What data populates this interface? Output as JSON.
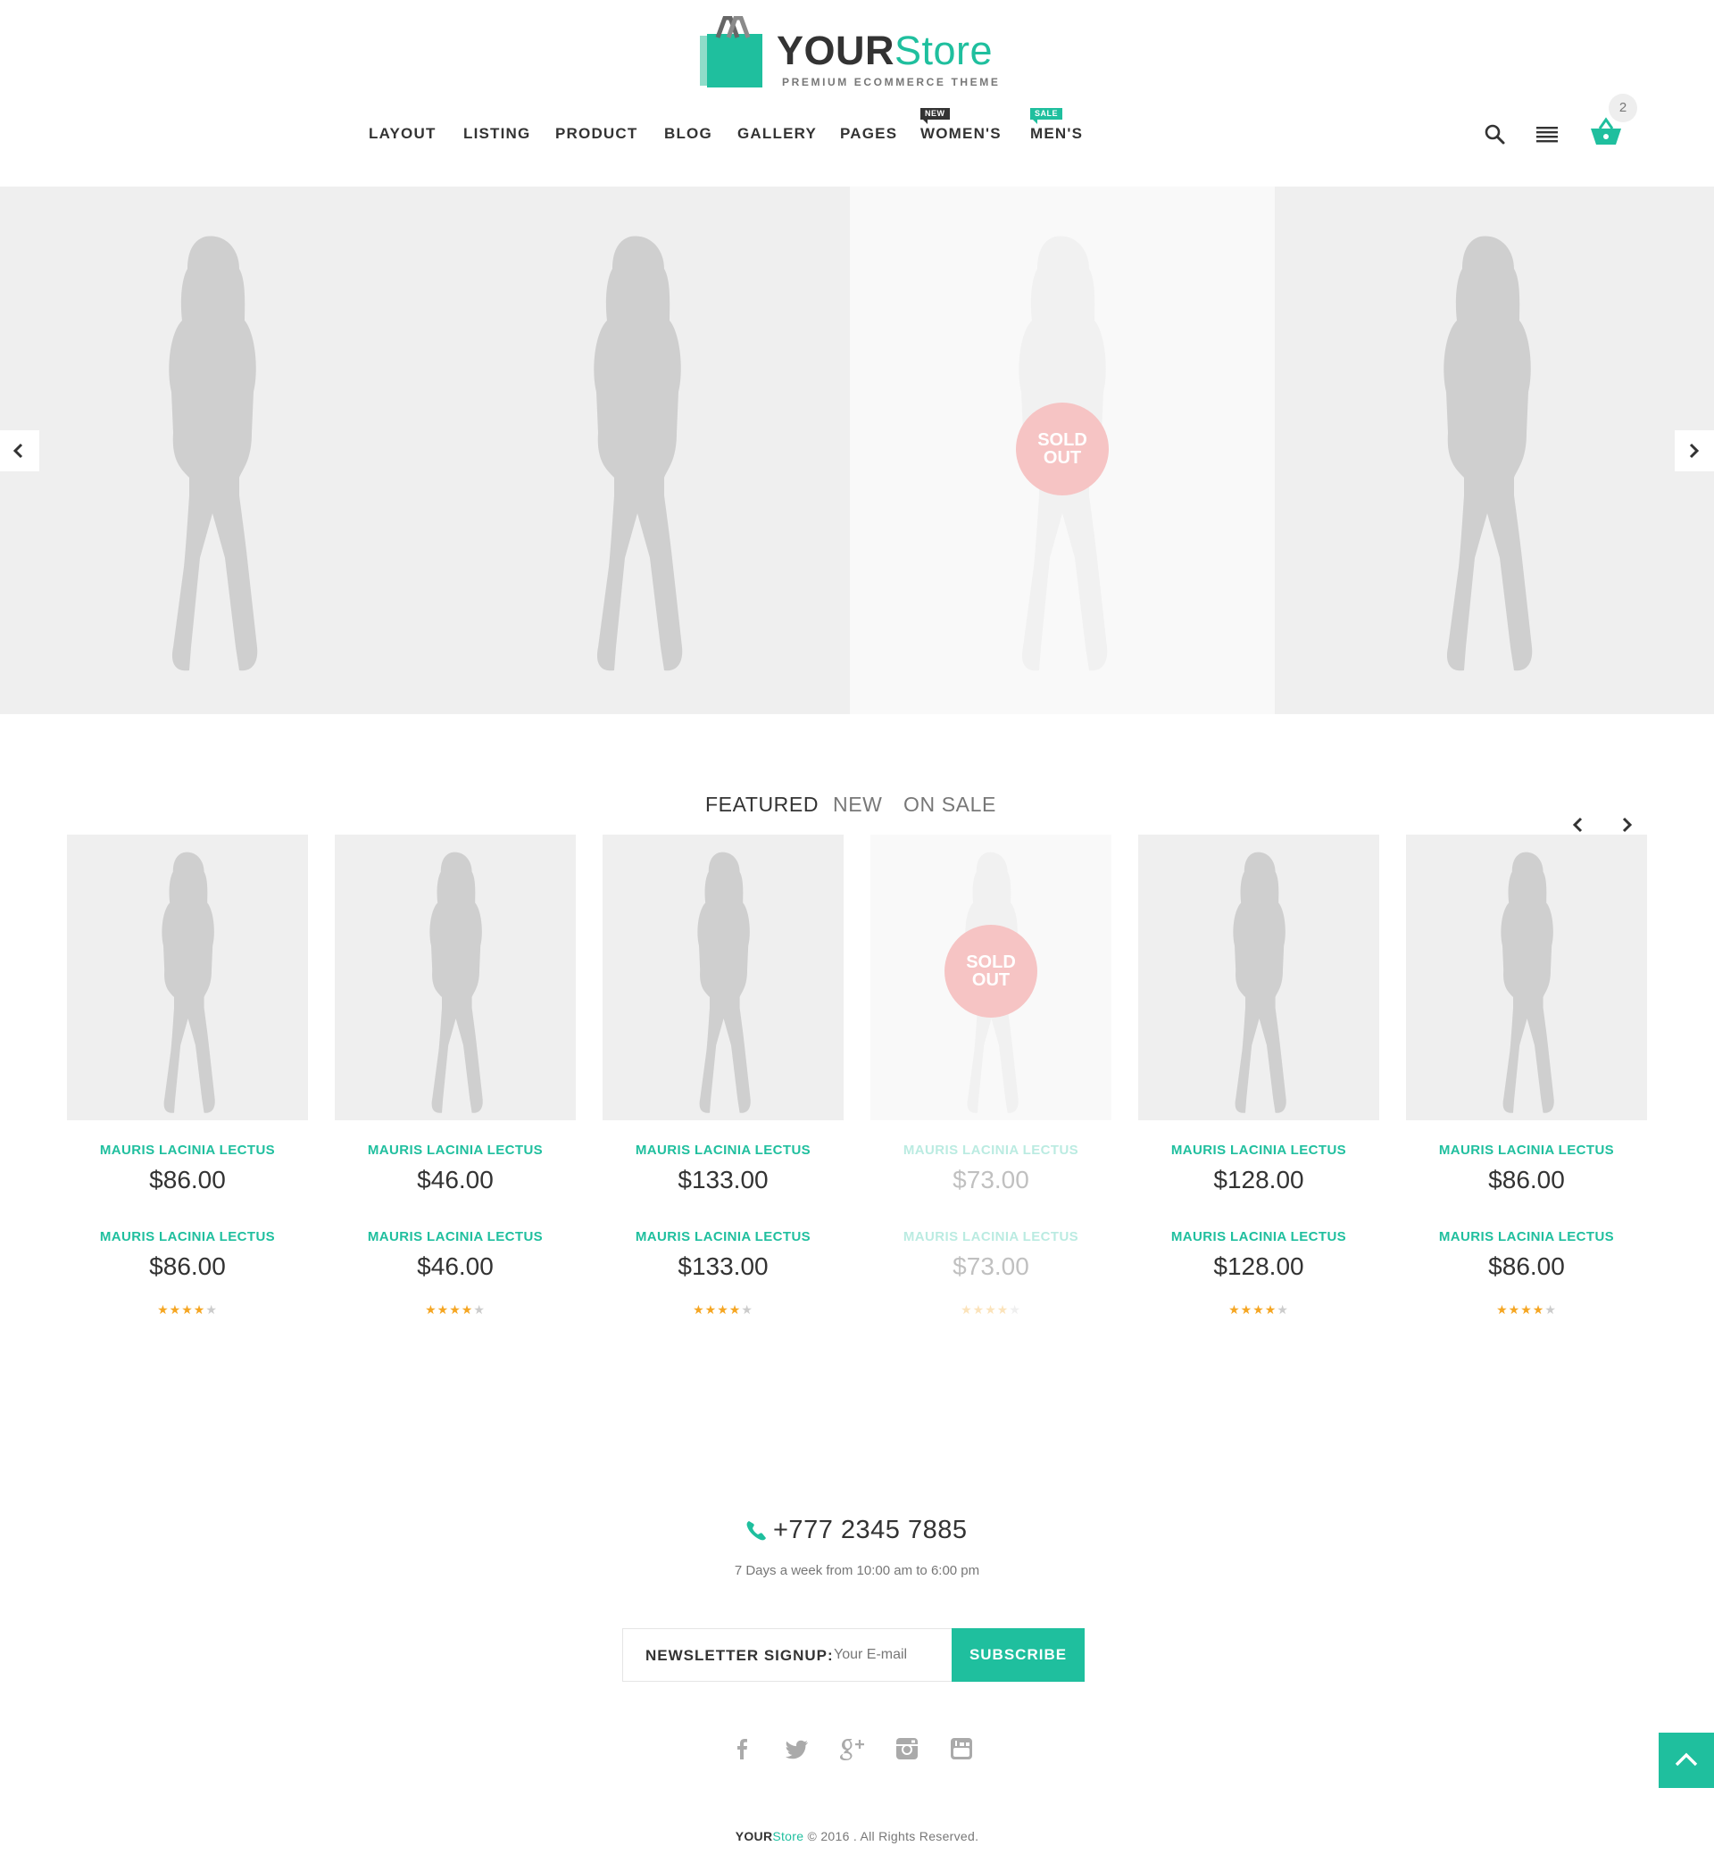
{
  "brand": {
    "name_part1": "YOUR",
    "name_part2": "Store",
    "tagline": "PREMIUM ECOMMERCE THEME"
  },
  "nav": {
    "items": [
      {
        "label": "LAYOUT"
      },
      {
        "label": "LISTING"
      },
      {
        "label": "PRODUCT"
      },
      {
        "label": "BLOG"
      },
      {
        "label": "GALLERY"
      },
      {
        "label": "PAGES"
      },
      {
        "label": "WOMEN'S",
        "badge": "NEW"
      },
      {
        "label": "MEN'S",
        "badge": "SALE"
      }
    ]
  },
  "header_icons": {
    "search": "search-icon",
    "menu": "menu-icon",
    "cart": "cart-icon",
    "cart_count": "2"
  },
  "hero": {
    "slides": [
      {
        "sold_out": false
      },
      {
        "sold_out": false
      },
      {
        "sold_out": true,
        "badge": "SOLD OUT"
      },
      {
        "sold_out": false
      }
    ],
    "sold_badge_line1": "SOLD",
    "sold_badge_line2": "OUT"
  },
  "tabs": {
    "items": [
      "FEATURED",
      "NEW",
      "ON SALE"
    ],
    "active": "FEATURED"
  },
  "products": [
    {
      "name": "MAURIS LACINIA LECTUS",
      "price": "$86.00",
      "name2": "MAURIS LACINIA LECTUS",
      "price2": "$86.00",
      "rating": 4,
      "sold_out": false
    },
    {
      "name": "MAURIS LACINIA LECTUS",
      "price": "$46.00",
      "name2": "MAURIS LACINIA LECTUS",
      "price2": "$46.00",
      "rating": 4,
      "sold_out": false
    },
    {
      "name": "MAURIS LACINIA LECTUS",
      "price": "$133.00",
      "name2": "MAURIS LACINIA LECTUS",
      "price2": "$133.00",
      "rating": 4,
      "sold_out": false
    },
    {
      "name": "MAURIS LACINIA LECTUS",
      "price": "$73.00",
      "name2": "MAURIS LACINIA LECTUS",
      "price2": "$73.00",
      "rating": 4,
      "sold_out": true
    },
    {
      "name": "MAURIS LACINIA LECTUS",
      "price": "$128.00",
      "name2": "MAURIS LACINIA LECTUS",
      "price2": "$128.00",
      "rating": 4,
      "sold_out": false
    },
    {
      "name": "MAURIS LACINIA LECTUS",
      "price": "$86.00",
      "name2": "MAURIS LACINIA LECTUS",
      "price2": "$86.00",
      "rating": 4,
      "sold_out": false
    }
  ],
  "footer": {
    "phone": "+777 2345 7885",
    "hours": "7 Days a week from 10:00 am to 6:00 pm",
    "newsletter_label": "NEWSLETTER SIGNUP:",
    "newsletter_placeholder": "Your E-mail",
    "subscribe_label": "SUBSCRIBE",
    "social": [
      "facebook-icon",
      "twitter-icon",
      "google-plus-icon",
      "instagram-icon",
      "youtube-icon"
    ],
    "copyright_part1": "YOUR",
    "copyright_part2": "Store",
    "copyright_rest": " © 2016 . All Rights Reserved."
  },
  "colors": {
    "accent": "#1fbf9e",
    "dark": "#333333",
    "sold_badge": "#f6c4c4",
    "star": "#f5a623"
  }
}
